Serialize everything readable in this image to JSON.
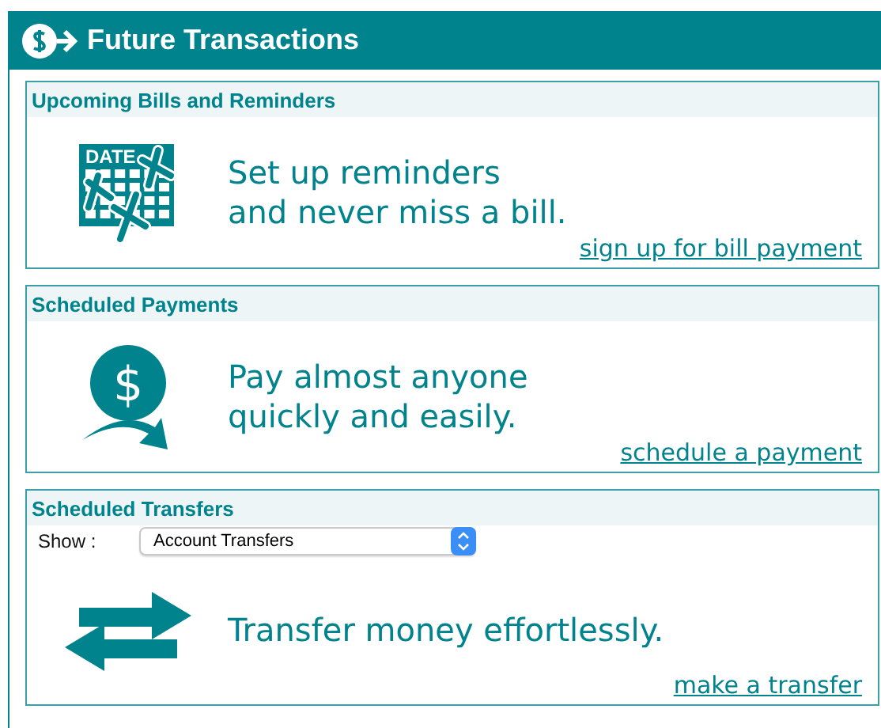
{
  "panel": {
    "title": "Future Transactions"
  },
  "cards": [
    {
      "kind": "bill",
      "title": "Upcoming Bills and Reminders",
      "icon_label": "DATE",
      "tagline": [
        "Set up reminders",
        "and never miss a bill."
      ],
      "link": "sign up for bill payment"
    },
    {
      "kind": "payment",
      "title": "Scheduled Payments",
      "icon_label": "$",
      "tagline": [
        "Pay almost anyone",
        "quickly and easily."
      ],
      "link": "schedule a payment"
    },
    {
      "kind": "transfer",
      "title": "Scheduled Transfers",
      "filter": {
        "label": "Show :",
        "value": "Account Transfers"
      },
      "tagline": [
        "Transfer money effortlessly."
      ],
      "link": "make a transfer"
    }
  ]
}
